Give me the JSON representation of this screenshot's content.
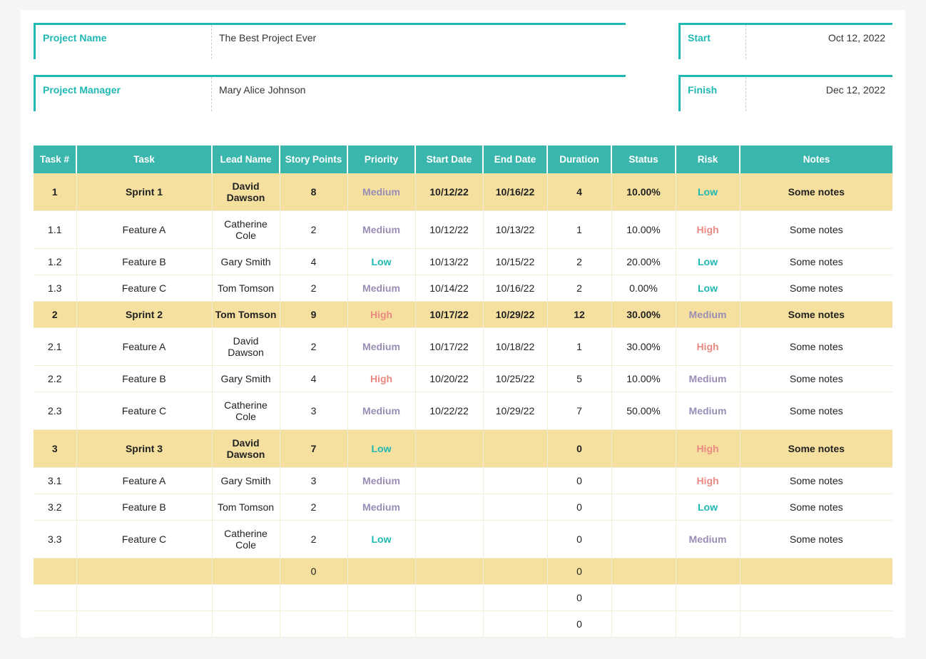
{
  "meta": {
    "projectNameLabel": "Project Name",
    "projectName": "The Best Project Ever",
    "projectManagerLabel": "Project Manager",
    "projectManager": "Mary Alice Johnson",
    "startLabel": "Start",
    "startDate": "Oct 12, 2022",
    "finishLabel": "Finish",
    "finishDate": "Dec 12, 2022"
  },
  "columns": [
    "Task #",
    "Task",
    "Lead Name",
    "Story Points",
    "Priority",
    "Start Date",
    "End Date",
    "Duration",
    "Status",
    "Risk",
    "Notes"
  ],
  "rows": [
    {
      "kind": "sprint",
      "num": "1",
      "task": "Sprint 1",
      "lead": "David Dawson",
      "pts": "8",
      "pri": "Medium",
      "start": "10/12/22",
      "end": "10/16/22",
      "dur": "4",
      "status": "10.00%",
      "risk": "Low",
      "notes": "Some notes"
    },
    {
      "kind": "plain",
      "num": "1.1",
      "task": "Feature A",
      "lead": "Catherine Cole",
      "pts": "2",
      "pri": "Medium",
      "start": "10/12/22",
      "end": "10/13/22",
      "dur": "1",
      "status": "10.00%",
      "risk": "High",
      "notes": "Some notes"
    },
    {
      "kind": "plain",
      "num": "1.2",
      "task": "Feature B",
      "lead": "Gary Smith",
      "pts": "4",
      "pri": "Low",
      "start": "10/13/22",
      "end": "10/15/22",
      "dur": "2",
      "status": "20.00%",
      "risk": "Low",
      "notes": "Some notes"
    },
    {
      "kind": "plain",
      "num": "1.3",
      "task": "Feature C",
      "lead": "Tom Tomson",
      "pts": "2",
      "pri": "Medium",
      "start": "10/14/22",
      "end": "10/16/22",
      "dur": "2",
      "status": "0.00%",
      "risk": "Low",
      "notes": "Some notes"
    },
    {
      "kind": "sprint",
      "num": "2",
      "task": "Sprint 2",
      "lead": "Tom Tomson",
      "pts": "9",
      "pri": "High",
      "start": "10/17/22",
      "end": "10/29/22",
      "dur": "12",
      "status": "30.00%",
      "risk": "Medium",
      "notes": "Some notes"
    },
    {
      "kind": "plain",
      "num": "2.1",
      "task": "Feature A",
      "lead": "David Dawson",
      "pts": "2",
      "pri": "Medium",
      "start": "10/17/22",
      "end": "10/18/22",
      "dur": "1",
      "status": "30.00%",
      "risk": "High",
      "notes": "Some notes"
    },
    {
      "kind": "plain",
      "num": "2.2",
      "task": "Feature B",
      "lead": "Gary Smith",
      "pts": "4",
      "pri": "High",
      "start": "10/20/22",
      "end": "10/25/22",
      "dur": "5",
      "status": "10.00%",
      "risk": "Medium",
      "notes": "Some notes"
    },
    {
      "kind": "plain",
      "num": "2.3",
      "task": "Feature C",
      "lead": "Catherine Cole",
      "pts": "3",
      "pri": "Medium",
      "start": "10/22/22",
      "end": "10/29/22",
      "dur": "7",
      "status": "50.00%",
      "risk": "Medium",
      "notes": "Some notes"
    },
    {
      "kind": "sprint",
      "num": "3",
      "task": "Sprint 3",
      "lead": "David Dawson",
      "pts": "7",
      "pri": "Low",
      "start": "",
      "end": "",
      "dur": "0",
      "status": "",
      "risk": "High",
      "notes": "Some notes"
    },
    {
      "kind": "plain",
      "num": "3.1",
      "task": "Feature A",
      "lead": "Gary Smith",
      "pts": "3",
      "pri": "Medium",
      "start": "",
      "end": "",
      "dur": "0",
      "status": "",
      "risk": "High",
      "notes": "Some notes"
    },
    {
      "kind": "plain",
      "num": "3.2",
      "task": "Feature B",
      "lead": "Tom Tomson",
      "pts": "2",
      "pri": "Medium",
      "start": "",
      "end": "",
      "dur": "0",
      "status": "",
      "risk": "Low",
      "notes": "Some notes"
    },
    {
      "kind": "plain",
      "num": "3.3",
      "task": "Feature C",
      "lead": "Catherine Cole",
      "pts": "2",
      "pri": "Low",
      "start": "",
      "end": "",
      "dur": "0",
      "status": "",
      "risk": "Medium",
      "notes": "Some notes"
    },
    {
      "kind": "empty-sprint",
      "num": "",
      "task": "",
      "lead": "",
      "pts": "0",
      "pri": "",
      "start": "",
      "end": "",
      "dur": "0",
      "status": "",
      "risk": "",
      "notes": ""
    },
    {
      "kind": "plain",
      "num": "",
      "task": "",
      "lead": "",
      "pts": "",
      "pri": "",
      "start": "",
      "end": "",
      "dur": "0",
      "status": "",
      "risk": "",
      "notes": ""
    },
    {
      "kind": "plain",
      "num": "",
      "task": "",
      "lead": "",
      "pts": "",
      "pri": "",
      "start": "",
      "end": "",
      "dur": "0",
      "status": "",
      "risk": "",
      "notes": ""
    }
  ]
}
